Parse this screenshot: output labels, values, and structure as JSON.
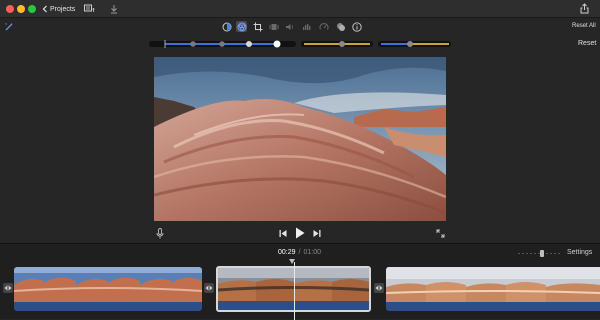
{
  "titlebar": {
    "back_label": "Projects"
  },
  "toolbar": {
    "reset_all_label": "Reset All",
    "reset_label": "Reset",
    "tools": [
      "color-balance-icon",
      "color-correction-icon",
      "crop-icon",
      "stabilization-icon",
      "volume-icon",
      "noise-reduction-icon",
      "speed-icon",
      "video-overlay-icon",
      "info-icon"
    ]
  },
  "timeline": {
    "current_time": "00:29",
    "separator": "/",
    "total_time": "01:00",
    "settings_label": "Settings"
  },
  "colors": {
    "accent_blue": "#3f6fd8",
    "selection_border": "#d8d8d8",
    "close": "#ff5f57",
    "minimize": "#febc2e",
    "maximize": "#28c840"
  }
}
